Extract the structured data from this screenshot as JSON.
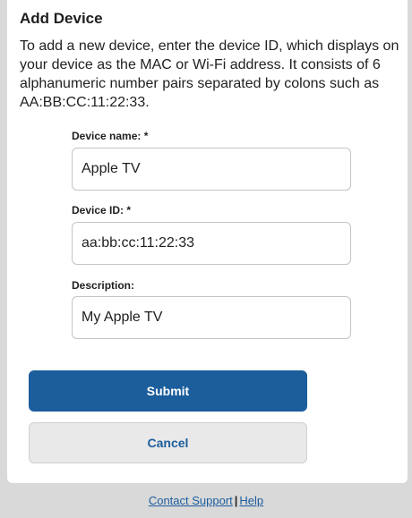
{
  "form": {
    "title": "Add Device",
    "instructions": "To add a new device, enter the device ID, which displays on your device as the MAC or Wi-Fi address. It consists of 6 alphanumeric number pairs separated by colons such as AA:BB:CC:11:22:33.",
    "fields": [
      {
        "label": "Device name: *",
        "value": "Apple TV"
      },
      {
        "label": "Device ID: *",
        "value": "aa:bb:cc:11:22:33"
      },
      {
        "label": "Description:",
        "value": "My Apple TV"
      }
    ],
    "submit_label": "Submit",
    "cancel_label": "Cancel"
  },
  "footer": {
    "contact_label": "Contact Support",
    "separator": "|",
    "help_label": "Help"
  },
  "colors": {
    "primary": "#1c5d9c",
    "background": "#d9d9d9",
    "card": "#ffffff"
  }
}
